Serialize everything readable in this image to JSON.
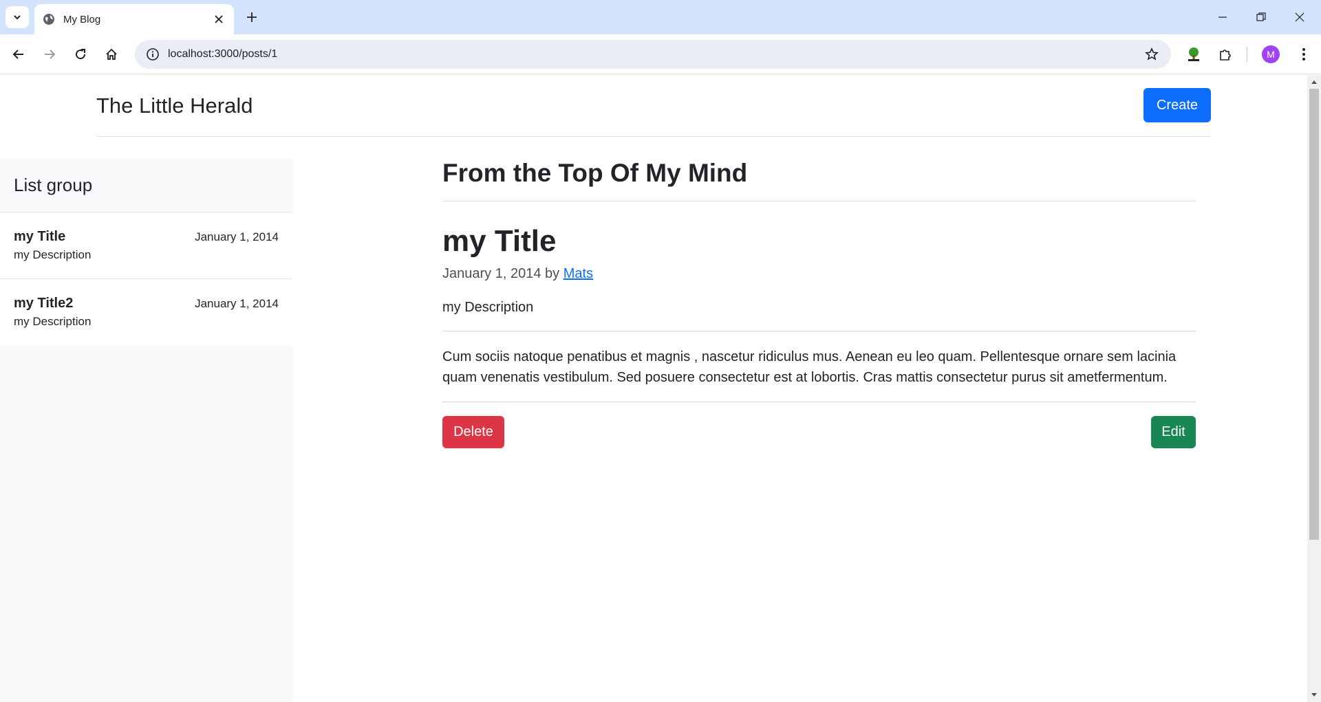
{
  "browser": {
    "tab_title": "My Blog",
    "url": "localhost:3000/posts/1",
    "profile_initial": "M",
    "icons": {
      "tab_search": "chevron-down-icon",
      "favicon": "globe-icon",
      "tab_close": "close-icon",
      "new_tab": "plus-icon",
      "back": "arrow-left-icon",
      "forward": "arrow-right-icon",
      "reload": "reload-icon",
      "home": "home-icon",
      "site_info": "info-icon",
      "bookmark": "star-icon",
      "extension_tree": "tree-extension-icon",
      "extensions": "puzzle-icon",
      "menu": "kebab-menu-icon"
    },
    "accent": "#d3e3fd"
  },
  "header": {
    "brand": "The Little Herald",
    "create_label": "Create"
  },
  "sidebar": {
    "heading": "List group",
    "items": [
      {
        "title": "my Title",
        "date": "January 1, 2014",
        "description": "my Description"
      },
      {
        "title": "my Title2",
        "date": "January 1, 2014",
        "description": "my Description"
      }
    ]
  },
  "main": {
    "section_title": "From the Top Of My Mind",
    "post": {
      "title": "my Title",
      "date": "January 1, 2014",
      "by": "by",
      "author": "Mats",
      "description": "my Description",
      "body": "Cum sociis natoque penatibus et magnis , nascetur ridiculus mus. Aenean eu leo quam. Pellentesque ornare sem lacinia quam venenatis vestibulum. Sed posuere consectetur est at lobortis. Cras mattis consectetur purus sit ametfermentum."
    },
    "delete_label": "Delete",
    "edit_label": "Edit"
  },
  "colors": {
    "primary": "#0d6efd",
    "danger": "#dc3545",
    "success": "#198754"
  }
}
